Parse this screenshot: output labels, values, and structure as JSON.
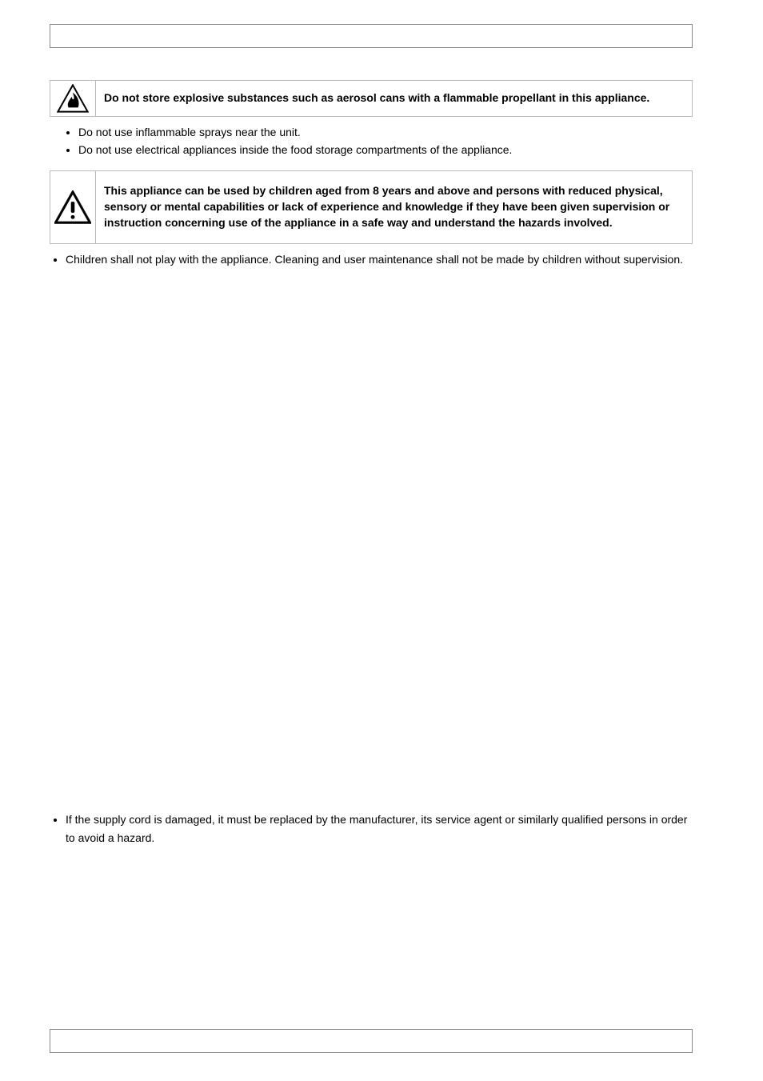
{
  "callout1": {
    "icon": "fire-warning-icon",
    "text": "Do not store explosive substances such as aerosol cans with a flammable propellant in this appliance."
  },
  "bullets1": [
    "Do not use inflammable sprays near the unit.",
    "Do not use electrical appliances inside the food storage compartments of the appliance."
  ],
  "callout2": {
    "icon": "warning-icon",
    "text": "This appliance can be used by children aged from 8 years and above and persons with reduced physical, sensory or mental capabilities or lack of experience and knowledge if they have been given supervision or instruction concerning use of the appliance in a safe way and understand the hazards involved."
  },
  "bullets2": [
    "Children shall not play with the appliance. Cleaning and user maintenance shall not be made by children without supervision."
  ],
  "bullets3": [
    "If the supply cord is damaged, it must be replaced by the manufacturer, its service agent or similarly qualified persons in order to avoid a hazard."
  ]
}
